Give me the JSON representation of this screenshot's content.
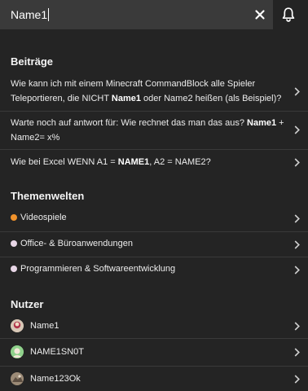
{
  "search": {
    "value": "Name1"
  },
  "sections": {
    "posts_title": "Beiträge",
    "topics_title": "Themenwelten",
    "users_title": "Nutzer"
  },
  "posts": [
    {
      "line1_a": "Wie kann ich mit einem Minecraft CommandBlock alle Spieler",
      "line2_a": "Teleportieren, die NICHT ",
      "line2_b": "Name1",
      "line2_c": " oder Name2 heißen (als Beispiel)?"
    },
    {
      "line1_a": "Warte noch auf antwort für: Wie rechnet das man das aus? ",
      "line1_b": "Name1",
      "line1_c": " +",
      "line2_a": "Name2= x%"
    },
    {
      "line1_a": "Wie bei Excel WENN A1 = ",
      "line1_b": "NAME1",
      "line1_c": ", A2 = NAME2?"
    }
  ],
  "topics": [
    {
      "label": "Videospiele",
      "dot_color": "#f0922b"
    },
    {
      "label": "Office- & Büroanwendungen",
      "dot_color": "#e8d6e6"
    },
    {
      "label": "Programmieren & Softwareentwicklung",
      "dot_color": "#e8d6e6"
    }
  ],
  "users": [
    {
      "name": "Name1",
      "avatar": "avatar-icon"
    },
    {
      "name": "NAME1SN0T",
      "avatar": "avatar-icon"
    },
    {
      "name": "Name123Ok",
      "avatar": "avatar-icon"
    }
  ],
  "colors": {
    "background": "#242424",
    "search_bg": "#3a3a3a",
    "divider": "#3a3a3a",
    "text": "#ececec"
  },
  "icons": {
    "clear": "close-icon",
    "bell": "bell-icon",
    "chevron": "chevron-right-icon"
  }
}
